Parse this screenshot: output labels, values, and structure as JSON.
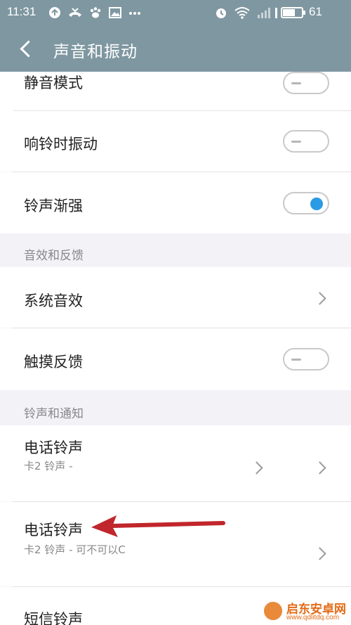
{
  "status_bar": {
    "time": "11:31",
    "battery": "61",
    "battery_level": 0.61,
    "left_icons": [
      "sync-icon",
      "missed-call-icon",
      "paw-icon",
      "image-icon",
      "more-dots-icon"
    ],
    "right_icons": [
      "alarm-icon",
      "wifi-icon",
      "signal-icon",
      "4g-signal-icon",
      "battery-icon"
    ]
  },
  "header": {
    "title": "声音和振动"
  },
  "rows": {
    "silent_mode": {
      "label": "静音模式",
      "toggle": false
    },
    "vibrate_on_ring": {
      "label": "响铃时振动",
      "toggle": false
    },
    "ring_crescendo": {
      "label": "铃声渐强",
      "toggle": true
    },
    "system_sound": {
      "label": "系统音效"
    },
    "touch_feedback": {
      "label": "触摸反馈",
      "toggle": false
    },
    "phone_ringtone_1": {
      "label": "电话铃声",
      "sub": "卡2 铃声 -"
    },
    "phone_ringtone_2": {
      "label": "电话铃声",
      "sub": "卡2 铃声 - 可不可以C"
    },
    "sms_ringtone": {
      "label": "短信铃声"
    }
  },
  "sections": {
    "sound_feedback": "音效和反馈",
    "ringtone_notification": "铃声和通知"
  },
  "watermark": {
    "text": "启东安卓网",
    "url": "www.qdlitdq.com"
  },
  "colors": {
    "app_bar": "#7f97a1",
    "toggle_on": "#2a9be4",
    "arrow": "#c0262b",
    "watermark": "#e36a16"
  }
}
